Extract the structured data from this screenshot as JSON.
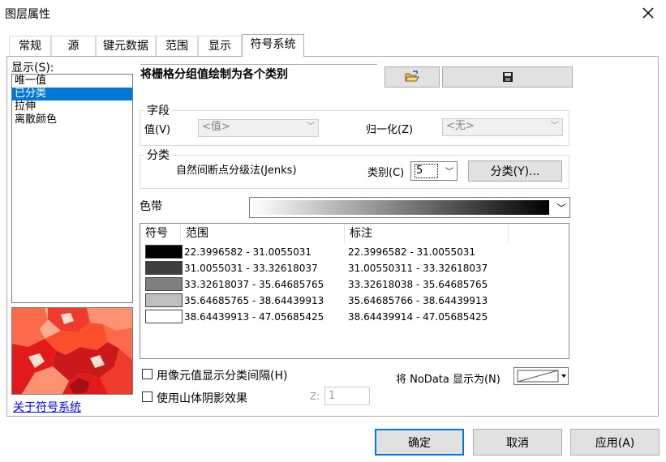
{
  "window": {
    "title": "图层属性"
  },
  "tabs": [
    {
      "label": "常规"
    },
    {
      "label": "源"
    },
    {
      "label": "键元数据"
    },
    {
      "label": "范围"
    },
    {
      "label": "显示"
    },
    {
      "label": "符号系统"
    }
  ],
  "sidebar": {
    "show_label": "显示(S):",
    "items": [
      {
        "label": "唯一值"
      },
      {
        "label": "已分类"
      },
      {
        "label": "拉伸"
      },
      {
        "label": "离散颜色"
      }
    ],
    "about_link": "关于符号系统"
  },
  "header": {
    "description": "将栅格分组值绘制为各个类别"
  },
  "fields": {
    "legend": "字段",
    "value_label": "值(V)",
    "value_select": "<值>",
    "normalize_label": "归一化(Z)",
    "normalize_select": "<无>"
  },
  "classification": {
    "legend": "分类",
    "method": "自然间断点分级法(Jenks)",
    "classes_label": "类别(C)",
    "classes_value": "5",
    "classify_button": "分类(Y)..."
  },
  "color_ramp": {
    "label": "色带"
  },
  "table": {
    "headers": {
      "symbol": "符号",
      "range": "范围",
      "label": "标注"
    },
    "rows": [
      {
        "color": "#000000",
        "range": "22.3996582 - 31.0055031",
        "label": "22.3996582 - 31.0055031"
      },
      {
        "color": "#3f3f3f",
        "range": "31.0055031 - 33.32618037",
        "label": "31.00550311 - 33.32618037"
      },
      {
        "color": "#7f7f7f",
        "range": "33.32618037 - 35.64685765",
        "label": "33.32618038 - 35.64685765"
      },
      {
        "color": "#bfbfbf",
        "range": "35.64685765 - 38.64439913",
        "label": "35.64685766 - 38.64439913"
      },
      {
        "color": "#ffffff",
        "range": "38.64439913 - 47.05685425",
        "label": "38.64439914 - 47.05685425"
      }
    ]
  },
  "options": {
    "show_class_breaks": "用像元值显示分类间隔(H)",
    "use_hillshade": "使用山体阴影效果",
    "z_label": "Z:",
    "z_value": "1",
    "nodata_label": "将 NoData 显示为(N)"
  },
  "footer": {
    "ok": "确定",
    "cancel": "取消",
    "apply": "应用(A)"
  },
  "icons": {
    "open": "folder-open-icon",
    "save": "save-icon",
    "close": "close-icon"
  },
  "colors": {
    "selection": "#0078d7",
    "preview_dark": "#e31a1c",
    "preview_light": "#fc9272"
  }
}
